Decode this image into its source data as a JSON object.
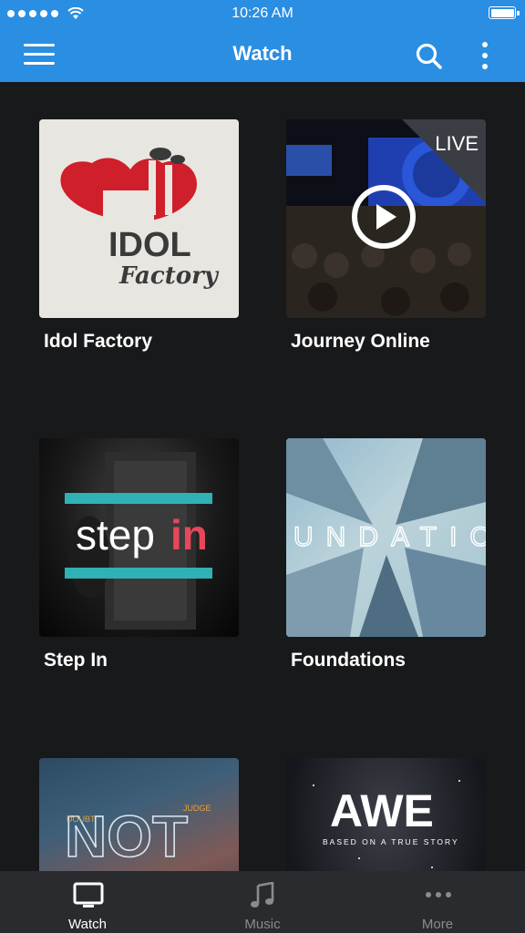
{
  "status_bar": {
    "time": "10:26 AM",
    "signal_dots": 5,
    "battery_level": 1.0
  },
  "header": {
    "title": "Watch",
    "menu_icon": "hamburger-menu-icon",
    "search_icon": "search-icon",
    "more_icon": "vertical-ellipsis-icon"
  },
  "media": [
    {
      "title": "Idol Factory",
      "art_text": [
        "IDOL",
        "Factory"
      ]
    },
    {
      "title": "Journey Online",
      "badge": "LIVE",
      "art_icon": "play-icon"
    },
    {
      "title": "Step In",
      "art_text": [
        "step",
        "in"
      ]
    },
    {
      "title": "Foundations",
      "art_text": [
        "UNDATIO"
      ]
    },
    {
      "title": "",
      "art_text": [
        "NOT",
        "DOUBT",
        "JUDGE"
      ]
    },
    {
      "title": "",
      "art_text": [
        "AWE",
        "BASED ON A TRUE STORY"
      ]
    }
  ],
  "tabs": [
    {
      "label": "Watch",
      "icon": "tv-icon",
      "active": true
    },
    {
      "label": "Music",
      "icon": "music-note-icon",
      "active": false
    },
    {
      "label": "More",
      "icon": "ellipsis-icon",
      "active": false
    }
  ],
  "colors": {
    "accent": "#2a8ee3",
    "background": "#18191b",
    "tab_bar": "#2a2b2e",
    "stepin_red": "#e8475a",
    "stepin_teal": "#2fb1b5",
    "idol_red": "#cf1f2a"
  }
}
